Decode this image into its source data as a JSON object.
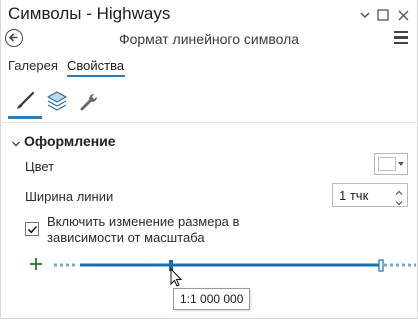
{
  "window": {
    "title": "Символы - Highways",
    "panel_title": "Формат линейного символа"
  },
  "tabs": [
    {
      "label": "Галерея",
      "active": false
    },
    {
      "label": "Свойства",
      "active": true
    }
  ],
  "subtabs": [
    {
      "icon": "brush-icon",
      "active": true
    },
    {
      "icon": "layers-icon",
      "active": false
    },
    {
      "icon": "wrench-icon",
      "active": false
    }
  ],
  "section": {
    "title": "Оформление",
    "expanded": true
  },
  "fields": {
    "color_label": "Цвет",
    "color_value": "#ffffff",
    "width_label": "Ширина линии",
    "width_value": "1 тчк"
  },
  "scale_checkbox": {
    "checked": true,
    "label": "Включить изменение размера в зависимости от масштаба"
  },
  "scale_slider": {
    "tooltip": "1:1 000 000"
  },
  "colors": {
    "accent": "#2b7bbf",
    "slider": "#1a6fb2",
    "plus": "#2e8b3a"
  }
}
